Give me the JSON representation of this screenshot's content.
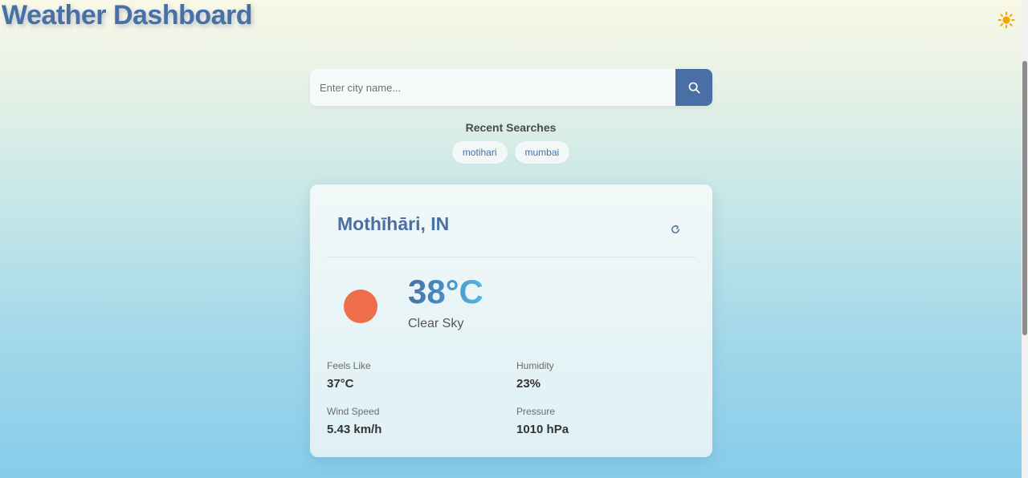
{
  "header": {
    "title": "Weather Dashboard",
    "theme_icon": "sun-icon"
  },
  "search": {
    "placeholder": "Enter city name...",
    "value": "",
    "button_icon": "search-icon"
  },
  "recent": {
    "title": "Recent Searches",
    "items": [
      "motihari",
      "mumbai"
    ]
  },
  "weather": {
    "city": "Mothīhāri, IN",
    "temperature": "38°C",
    "condition": "Clear Sky",
    "icon": "sun-icon",
    "details": [
      {
        "label": "Feels Like",
        "value": "37°C"
      },
      {
        "label": "Humidity",
        "value": "23%"
      },
      {
        "label": "Wind Speed",
        "value": "5.43 km/h"
      },
      {
        "label": "Pressure",
        "value": "1010 hPa"
      }
    ]
  },
  "colors": {
    "accent": "#4a6fa5",
    "sun": "#ee6e4c",
    "theme_icon": "#f5a500"
  }
}
